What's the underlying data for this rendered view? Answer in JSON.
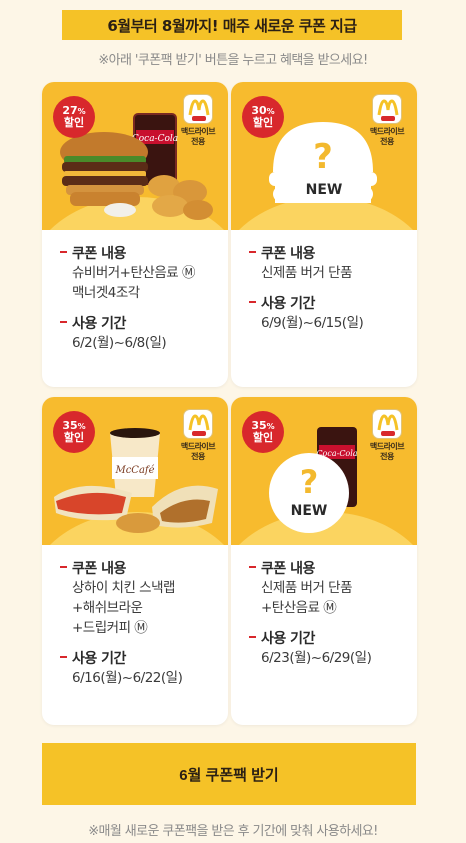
{
  "banner": {
    "title": "6월부터 8월까지! 매주 새로운 쿠폰 지급"
  },
  "notice_top": "※아래 '쿠폰팩 받기' 버튼을 누르고 혜택을 받으세요!",
  "app_label_line1": "맥드라이브",
  "app_label_line2": "전용",
  "coupon_heading": "쿠폰 내용",
  "period_heading": "사용 기간",
  "discount_word": "할인",
  "new_label": "NEW",
  "cards": [
    {
      "percent": "27",
      "lines": [
        "슈비버거+탄산음료 Ⓜ",
        "맥너겟4조각"
      ],
      "period": "6/2(월)~6/8(일)"
    },
    {
      "percent": "30",
      "lines": [
        "신제품 버거 단품"
      ],
      "period": "6/9(월)~6/15(일)"
    },
    {
      "percent": "35",
      "lines": [
        "상하이 치킨 스낵랩",
        "+해쉬브라운",
        "+드립커피 Ⓜ"
      ],
      "period": "6/16(월)~6/22(일)"
    },
    {
      "percent": "35",
      "lines": [
        "신제품 버거 단품",
        "+탄산음료 Ⓜ"
      ],
      "period": "6/23(월)~6/29(일)"
    }
  ],
  "button": {
    "label": "6월 쿠폰팩 받기"
  },
  "notice_bottom": "※매월 새로운 쿠폰팩을 받은 후 기간에 맞춰 사용하세요!",
  "colors": {
    "accent_yellow": "#f5c227",
    "badge_red": "#d8282c",
    "background": "#fdf6e7"
  }
}
